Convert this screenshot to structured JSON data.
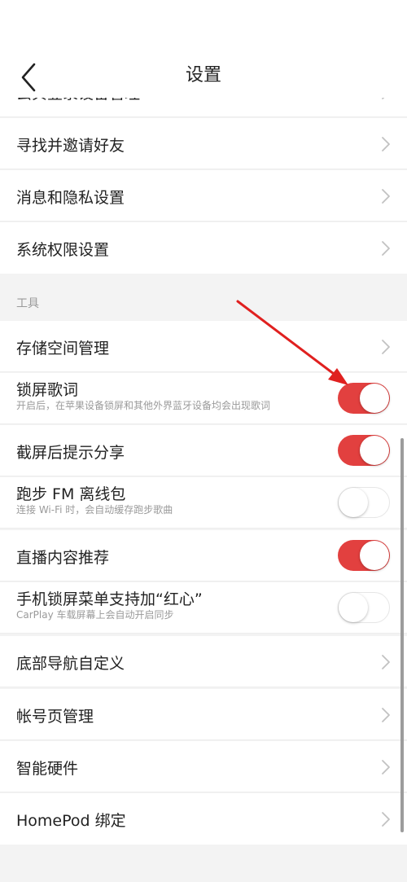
{
  "header": {
    "title": "设置",
    "back_icon": "chevron-left-icon"
  },
  "rows": {
    "account_security": "云贝登录设备管理",
    "find_invite_friends": "寻找并邀请好友",
    "message_privacy": "消息和隐私设置",
    "system_permissions": "系统权限设置"
  },
  "tools_section": {
    "title": "工具"
  },
  "tools": {
    "storage": "存储空间管理",
    "lockscreen_lyrics": {
      "label": "锁屏歌词",
      "desc": "开启后，在苹果设备锁屏和其他外界蓝牙设备均会出现歌词",
      "on": true
    },
    "screenshot_share": {
      "label": "截屏后提示分享",
      "on": true
    },
    "running_fm": {
      "label": "跑步 FM 离线包",
      "desc": "连接 Wi-Fi 时，会自动缓存跑步歌曲",
      "on": false
    },
    "live_recommend": {
      "label": "直播内容推荐",
      "on": true
    },
    "lockscreen_heart": {
      "label": "手机锁屏菜单支持加“红心”",
      "desc": "CarPlay 车载屏幕上会自动开启同步",
      "on": false
    },
    "bottom_nav": "底部导航自定义",
    "account_page": "帐号页管理",
    "smart_hardware": "智能硬件",
    "homepod": "HomePod 绑定"
  },
  "colors": {
    "toggle_on": "#e2403f",
    "annotation_arrow": "#e0201f",
    "background": "#f3f3f3"
  }
}
